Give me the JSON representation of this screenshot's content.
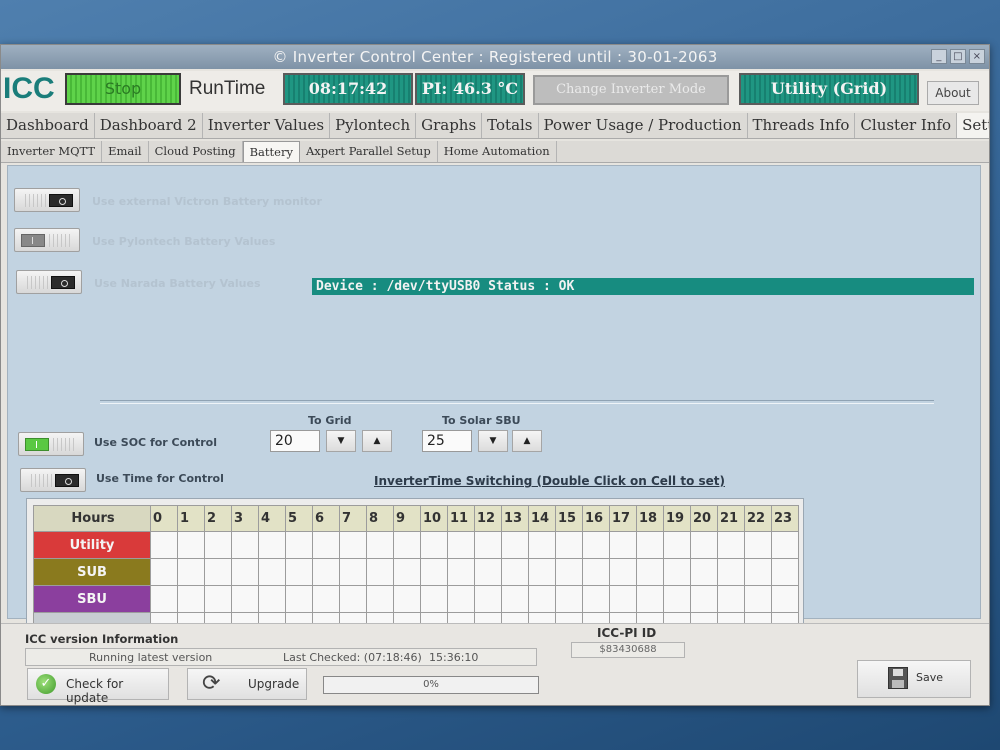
{
  "window": {
    "title": "© Inverter Control Center : Registered until : 30-01-2063"
  },
  "toolbar": {
    "logo": "ICC",
    "stop_label": "Stop",
    "runtime_label": "RunTime",
    "runtime_value": "08:17:42",
    "pi_temp": "PI: 46.3 °C",
    "change_mode_label": "Change Inverter Mode",
    "mode_value": "Utility (Grid)",
    "about_label": "About"
  },
  "main_tabs": [
    "Dashboard",
    "Dashboard 2",
    "Inverter Values",
    "Pylontech",
    "Graphs",
    "Totals",
    "Power Usage / Production",
    "Threads Info",
    "Cluster Info",
    "Settings"
  ],
  "main_tab_active": "Settings",
  "sub_tabs": [
    "Inverter MQTT",
    "Email",
    "Cloud Posting",
    "Battery",
    "Axpert Parallel Setup",
    "Home Automation"
  ],
  "sub_tab_active": "Battery",
  "battery": {
    "victron_label": "Use external Victron Battery monitor",
    "pylontech_label": "Use Pylontech Battery Values",
    "narada_label": "Use Narada Battery Values",
    "device_status": "Device : /dev/ttyUSB0 Status : OK",
    "soc_label": "Use SOC for Control",
    "time_label": "Use Time for Control",
    "to_grid_label": "To Grid",
    "to_grid_value": "20",
    "to_solar_label": "To Solar SBU",
    "to_solar_value": "25",
    "grid_title": "InverterTime Switching  (Double Click on Cell to set)"
  },
  "schedule": {
    "hours_label": "Hours",
    "hours": [
      "0",
      "1",
      "2",
      "3",
      "4",
      "5",
      "6",
      "7",
      "8",
      "9",
      "10",
      "11",
      "12",
      "13",
      "14",
      "15",
      "16",
      "17",
      "18",
      "19",
      "20",
      "21",
      "22",
      "23"
    ],
    "rows": [
      {
        "label": "Utility",
        "color": "#d93a3a"
      },
      {
        "label": "SUB",
        "color": "#8a7a1e"
      },
      {
        "label": "SBU",
        "color": "#8b3f9e"
      },
      {
        "label": "",
        "color": "#c8cdd2"
      }
    ]
  },
  "footer": {
    "version_heading": "ICC version Information",
    "version_status": "Running latest version",
    "last_checked": "Last Checked: (07:18:46)",
    "last_checked_time": "15:36:10",
    "pi_id_heading": "ICC-PI ID",
    "pi_id_value": "$83430688",
    "check_update_label": "Check for update",
    "upgrade_label": "Upgrade",
    "progress_text": "0%",
    "save_label": "Save"
  },
  "colors": {
    "teal": "#1f9682",
    "green": "#5fd34a"
  }
}
